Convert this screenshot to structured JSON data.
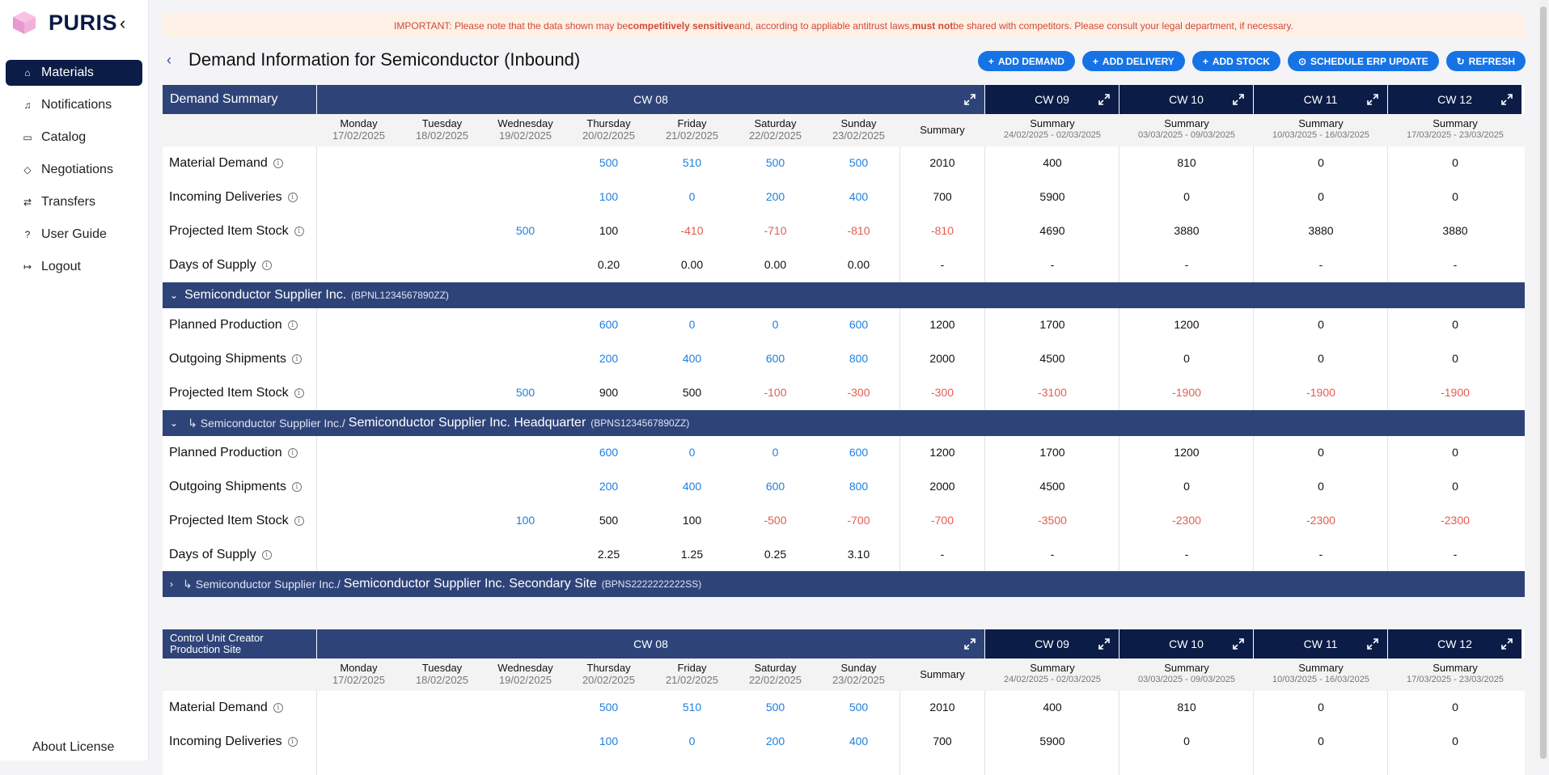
{
  "app": {
    "name": "PURIS"
  },
  "sidebar": {
    "items": [
      {
        "label": "Materials",
        "icon": "home-icon",
        "active": true
      },
      {
        "label": "Notifications",
        "icon": "bell-icon"
      },
      {
        "label": "Catalog",
        "icon": "catalog-icon"
      },
      {
        "label": "Negotiations",
        "icon": "tag-icon"
      },
      {
        "label": "Transfers",
        "icon": "transfer-icon"
      },
      {
        "label": "User Guide",
        "icon": "help-icon"
      },
      {
        "label": "Logout",
        "icon": "logout-icon"
      }
    ],
    "about": "About License"
  },
  "banner": {
    "p1": "IMPORTANT: Please note that the data shown may be ",
    "b1": "competitively sensitive",
    "p2": " and, according to appliable antitrust laws, ",
    "b2": "must not",
    "p3": " be shared with competitors. Please consult your legal department, if necessary."
  },
  "header": {
    "title": "Demand Information for Semiconductor (Inbound)",
    "buttons": [
      {
        "label": "ADD DEMAND",
        "icon": "+"
      },
      {
        "label": "ADD DELIVERY",
        "icon": "+"
      },
      {
        "label": "ADD STOCK",
        "icon": "+"
      },
      {
        "label": "SCHEDULE ERP UPDATE",
        "icon": "⊙"
      },
      {
        "label": "REFRESH",
        "icon": "↻"
      }
    ]
  },
  "columns": {
    "cw08": "CW 08",
    "days": [
      {
        "name": "Monday",
        "date": "17/02/2025"
      },
      {
        "name": "Tuesday",
        "date": "18/02/2025"
      },
      {
        "name": "Wednesday",
        "date": "19/02/2025"
      },
      {
        "name": "Thursday",
        "date": "20/02/2025"
      },
      {
        "name": "Friday",
        "date": "21/02/2025"
      },
      {
        "name": "Saturday",
        "date": "22/02/2025"
      },
      {
        "name": "Sunday",
        "date": "23/02/2025"
      }
    ],
    "summary": "Summary",
    "weeks": [
      {
        "label": "CW 09",
        "range": "24/02/2025 - 02/03/2025"
      },
      {
        "label": "CW 10",
        "range": "03/03/2025 - 09/03/2025"
      },
      {
        "label": "CW 11",
        "range": "10/03/2025 - 16/03/2025"
      },
      {
        "label": "CW 12",
        "range": "17/03/2025 - 23/03/2025"
      }
    ]
  },
  "summary_panel": {
    "title": "Demand Summary",
    "rows": [
      {
        "label": "Material Demand",
        "cells": [
          "",
          "",
          "",
          "500",
          "510",
          "500",
          "500",
          "2010",
          "400",
          "810",
          "0",
          "0"
        ],
        "colors": [
          "",
          "",
          "",
          "b",
          "b",
          "b",
          "b",
          "k",
          "k",
          "k",
          "k",
          "k"
        ]
      },
      {
        "label": "Incoming Deliveries",
        "cells": [
          "",
          "",
          "",
          "100",
          "0",
          "200",
          "400",
          "700",
          "5900",
          "0",
          "0",
          "0"
        ],
        "colors": [
          "",
          "",
          "",
          "b",
          "b",
          "b",
          "b",
          "k",
          "k",
          "k",
          "k",
          "k"
        ]
      },
      {
        "label": "Projected Item Stock",
        "cells": [
          "",
          "",
          "500",
          "100",
          "-410",
          "-710",
          "-810",
          "-810",
          "4690",
          "3880",
          "3880",
          "3880"
        ],
        "colors": [
          "",
          "",
          "b",
          "k",
          "r",
          "r",
          "r",
          "r",
          "k",
          "k",
          "k",
          "k"
        ]
      },
      {
        "label": "Days of Supply",
        "cells": [
          "",
          "",
          "",
          "0.20",
          "0.00",
          "0.00",
          "0.00",
          "-",
          "-",
          "-",
          "-",
          "-"
        ],
        "colors": [
          "",
          "",
          "",
          "k",
          "k",
          "k",
          "k",
          "k",
          "k",
          "k",
          "k",
          "k"
        ]
      }
    ]
  },
  "supplier": {
    "name": "Semiconductor Supplier Inc.",
    "bpnl": "(BPNL1234567890ZZ)",
    "rows": [
      {
        "label": "Planned Production",
        "cells": [
          "",
          "",
          "",
          "600",
          "0",
          "0",
          "600",
          "1200",
          "1700",
          "1200",
          "0",
          "0"
        ],
        "colors": [
          "",
          "",
          "",
          "b",
          "b",
          "b",
          "b",
          "k",
          "k",
          "k",
          "k",
          "k"
        ]
      },
      {
        "label": "Outgoing Shipments",
        "cells": [
          "",
          "",
          "",
          "200",
          "400",
          "600",
          "800",
          "2000",
          "4500",
          "0",
          "0",
          "0"
        ],
        "colors": [
          "",
          "",
          "",
          "b",
          "b",
          "b",
          "b",
          "k",
          "k",
          "k",
          "k",
          "k"
        ]
      },
      {
        "label": "Projected Item Stock",
        "cells": [
          "",
          "",
          "500",
          "900",
          "500",
          "-100",
          "-300",
          "-300",
          "-3100",
          "-1900",
          "-1900",
          "-1900"
        ],
        "colors": [
          "",
          "",
          "b",
          "k",
          "k",
          "r",
          "r",
          "r",
          "r",
          "r",
          "r",
          "r"
        ]
      }
    ]
  },
  "site1": {
    "prefix": "Semiconductor Supplier Inc./",
    "name": "Semiconductor Supplier Inc. Headquarter",
    "bpns": "(BPNS1234567890ZZ)",
    "rows": [
      {
        "label": "Planned Production",
        "cells": [
          "",
          "",
          "",
          "600",
          "0",
          "0",
          "600",
          "1200",
          "1700",
          "1200",
          "0",
          "0"
        ],
        "colors": [
          "",
          "",
          "",
          "b",
          "b",
          "b",
          "b",
          "k",
          "k",
          "k",
          "k",
          "k"
        ]
      },
      {
        "label": "Outgoing Shipments",
        "cells": [
          "",
          "",
          "",
          "200",
          "400",
          "600",
          "800",
          "2000",
          "4500",
          "0",
          "0",
          "0"
        ],
        "colors": [
          "",
          "",
          "",
          "b",
          "b",
          "b",
          "b",
          "k",
          "k",
          "k",
          "k",
          "k"
        ]
      },
      {
        "label": "Projected Item Stock",
        "cells": [
          "",
          "",
          "100",
          "500",
          "100",
          "-500",
          "-700",
          "-700",
          "-3500",
          "-2300",
          "-2300",
          "-2300"
        ],
        "colors": [
          "",
          "",
          "b",
          "k",
          "k",
          "r",
          "r",
          "r",
          "r",
          "r",
          "r",
          "r"
        ]
      },
      {
        "label": "Days of Supply",
        "cells": [
          "",
          "",
          "",
          "2.25",
          "1.25",
          "0.25",
          "3.10",
          "-",
          "-",
          "-",
          "-",
          "-"
        ],
        "colors": [
          "",
          "",
          "",
          "k",
          "k",
          "k",
          "k",
          "k",
          "k",
          "k",
          "k",
          "k"
        ]
      }
    ]
  },
  "site2": {
    "prefix": "Semiconductor Supplier Inc./",
    "name": "Semiconductor Supplier Inc. Secondary Site",
    "bpns": "(BPNS2222222222SS)"
  },
  "customer_panel": {
    "title": "Control Unit Creator Production Site",
    "rows": [
      {
        "label": "Material Demand",
        "cells": [
          "",
          "",
          "",
          "500",
          "510",
          "500",
          "500",
          "2010",
          "400",
          "810",
          "0",
          "0"
        ],
        "colors": [
          "",
          "",
          "",
          "b",
          "b",
          "b",
          "b",
          "k",
          "k",
          "k",
          "k",
          "k"
        ]
      },
      {
        "label": "Incoming Deliveries",
        "cells": [
          "",
          "",
          "",
          "100",
          "0",
          "200",
          "400",
          "700",
          "5900",
          "0",
          "0",
          "0"
        ],
        "colors": [
          "",
          "",
          "",
          "b",
          "b",
          "b",
          "b",
          "k",
          "k",
          "k",
          "k",
          "k"
        ]
      }
    ]
  }
}
